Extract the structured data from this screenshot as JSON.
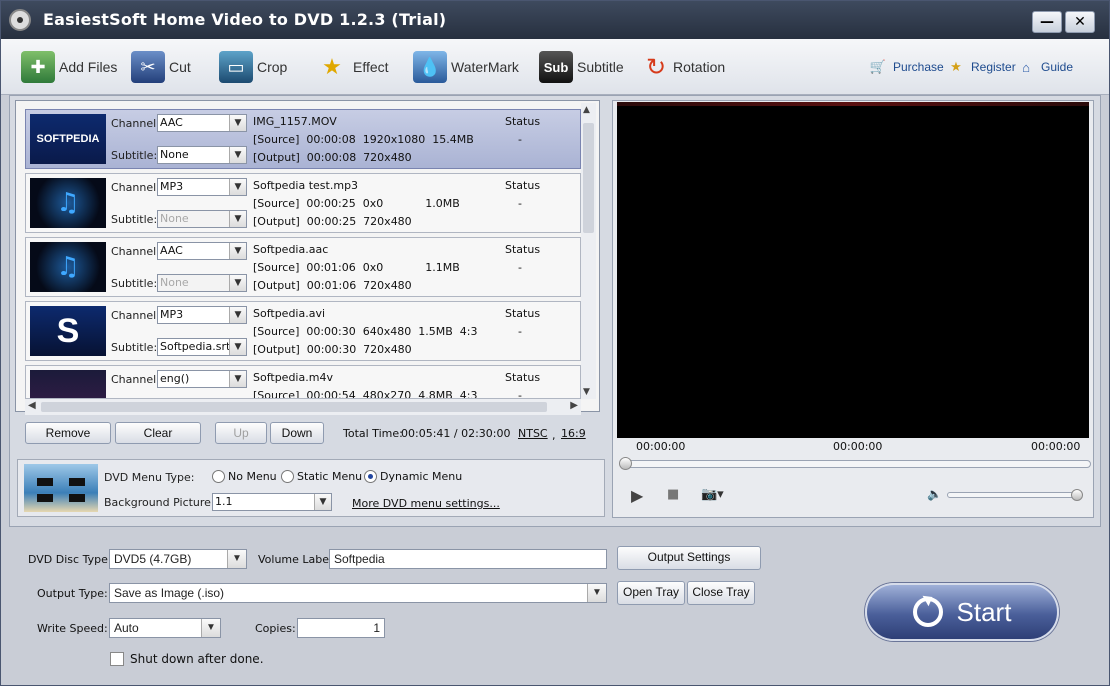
{
  "window": {
    "title": "EasiestSoft Home Video to DVD 1.2.3 (Trial)"
  },
  "toolbar": {
    "add_files": "Add Files",
    "cut": "Cut",
    "crop": "Crop",
    "effect": "Effect",
    "watermark": "WaterMark",
    "subtitle": "Subtitle",
    "rotation": "Rotation",
    "purchase": "Purchase",
    "register": "Register",
    "guide": "Guide"
  },
  "labels": {
    "channel": "Channel:",
    "subtitle": "Subtitle:",
    "status": "Status"
  },
  "files": [
    {
      "name": "IMG_1157.MOV",
      "channel": "AAC",
      "subtitle": "None",
      "subtitle_disabled": false,
      "source": "[Source]  00:00:08  1920x1080  15.4MB",
      "output": "[Output]  00:00:08  720x480",
      "status": "-",
      "thumb": "SOFTPEDIA"
    },
    {
      "name": "Softpedia test.mp3",
      "channel": "MP3",
      "subtitle": "None",
      "subtitle_disabled": true,
      "source": "[Source]  00:00:25  0x0            1.0MB",
      "output": "[Output]  00:00:25  720x480",
      "status": "-",
      "thumb": ""
    },
    {
      "name": "Softpedia.aac",
      "channel": "AAC",
      "subtitle": "None",
      "subtitle_disabled": true,
      "source": "[Source]  00:01:06  0x0            1.1MB",
      "output": "[Output]  00:01:06  720x480",
      "status": "-",
      "thumb": ""
    },
    {
      "name": "Softpedia.avi",
      "channel": "MP3",
      "subtitle": "Softpedia.srt",
      "subtitle_disabled": false,
      "source": "[Source]  00:00:30  640x480  1.5MB  4:3",
      "output": "[Output]  00:00:30  720x480",
      "status": "-",
      "thumb": "S"
    },
    {
      "name": "Softpedia.m4v",
      "channel": "eng()",
      "subtitle": "",
      "subtitle_disabled": false,
      "source": "[Source]  00:00:54  480x270  4.8MB  4:3",
      "output": "",
      "status": "-",
      "thumb": ""
    }
  ],
  "list_controls": {
    "remove": "Remove",
    "clear": "Clear",
    "up": "Up",
    "down": "Down",
    "total_time_label": "Total Time:",
    "total_time_value": "00:05:41 / 02:30:00",
    "standard": "NTSC",
    "comma": ",",
    "aspect": "16:9"
  },
  "dvd_menu": {
    "type_label": "DVD Menu Type:",
    "options": [
      "No Menu",
      "Static Menu",
      "Dynamic Menu"
    ],
    "selected": "Dynamic Menu",
    "background_label": "Background Picture:",
    "background_value": "1.1",
    "more_settings": "More DVD menu settings..."
  },
  "player": {
    "time_left": "00:00:00",
    "time_mid": "00:00:00",
    "time_right": "00:00:00",
    "progress": 0,
    "volume": 1.0
  },
  "output": {
    "disc_type_label": "DVD Disc Type:",
    "disc_type_value": "DVD5 (4.7GB)",
    "volume_label": "Volume Label:",
    "volume_value": "Softpedia",
    "output_settings": "Output Settings",
    "output_type_label": "Output Type:",
    "output_type_value": "Save as Image (.iso)",
    "open_tray": "Open Tray",
    "close_tray": "Close Tray",
    "write_speed_label": "Write Speed:",
    "write_speed_value": "Auto",
    "copies_label": "Copies:",
    "copies_value": "1",
    "shutdown_label": "Shut down after done.",
    "shutdown_checked": false,
    "start": "Start"
  },
  "colors": {
    "accent": "#2e3f76",
    "title_bg": "#27303f",
    "selected_row": "#aab3d4",
    "link": "#1e4b8e"
  }
}
